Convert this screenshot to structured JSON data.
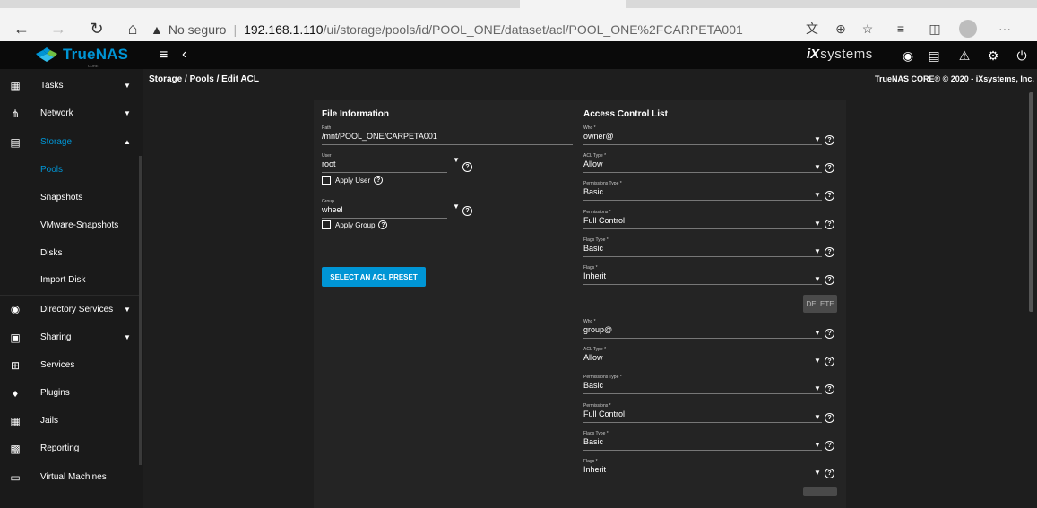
{
  "browser": {
    "insecure_label": "No seguro",
    "url_host": "192.168.1.110",
    "url_path": "/ui/storage/pools/id/POOL_ONE/dataset/acl/POOL_ONE%2FCARPETA001",
    "more_label": "···"
  },
  "app": {
    "logo_text": "TrueNAS",
    "logo_sub": "CORE",
    "ix_brand_mark": "iX",
    "ix_brand_text": "systems",
    "breadcrumb": "Storage / Pools / Edit ACL",
    "copyright": "TrueNAS CORE® © 2020 - iXsystems, Inc."
  },
  "sidebar": {
    "items": [
      {
        "label": "Tasks"
      },
      {
        "label": "Network"
      },
      {
        "label": "Storage"
      },
      {
        "label": "Pools"
      },
      {
        "label": "Snapshots"
      },
      {
        "label": "VMware-Snapshots"
      },
      {
        "label": "Disks"
      },
      {
        "label": "Import Disk"
      },
      {
        "label": "Directory Services"
      },
      {
        "label": "Sharing"
      },
      {
        "label": "Services"
      },
      {
        "label": "Plugins"
      },
      {
        "label": "Jails"
      },
      {
        "label": "Reporting"
      },
      {
        "label": "Virtual Machines"
      }
    ]
  },
  "file_info": {
    "title": "File Information",
    "path_label": "Path",
    "path_value": "/mnt/POOL_ONE/CARPETA001",
    "user_label": "User",
    "user_value": "root",
    "apply_user_label": "Apply User",
    "group_label": "Group",
    "group_value": "wheel",
    "apply_group_label": "Apply Group",
    "preset_button": "SELECT AN ACL PRESET"
  },
  "acl": {
    "title": "Access Control List",
    "delete_label": "DELETE",
    "entries": [
      {
        "who_label": "Who *",
        "who": "owner@",
        "acl_type_label": "ACL Type *",
        "acl_type": "Allow",
        "perm_type_label": "Permissions Type *",
        "perm_type": "Basic",
        "perms_label": "Permissions *",
        "perms": "Full Control",
        "flags_type_label": "Flags Type *",
        "flags_type": "Basic",
        "flags_label": "Flags *",
        "flags": "Inherit"
      },
      {
        "who_label": "Who *",
        "who": "group@",
        "acl_type_label": "ACL Type *",
        "acl_type": "Allow",
        "perm_type_label": "Permissions Type *",
        "perm_type": "Basic",
        "perms_label": "Permissions *",
        "perms": "Full Control",
        "flags_type_label": "Flags Type *",
        "flags_type": "Basic",
        "flags_label": "Flags *",
        "flags": "Inherit"
      }
    ]
  },
  "colors": {
    "accent": "#0095d5",
    "sidebar_bg": "#1a1a1a",
    "topbar_bg": "#0a0a0a",
    "card_bg": "#242424"
  }
}
